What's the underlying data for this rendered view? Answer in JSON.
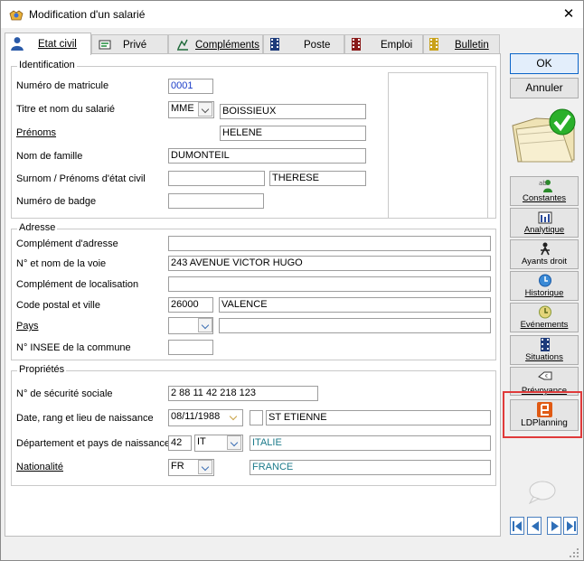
{
  "window": {
    "title": "Modification d'un salarié",
    "close": "✕"
  },
  "tabs": [
    {
      "label": "Etat civil",
      "icon": "person-icon",
      "active": true
    },
    {
      "label": "Privé",
      "icon": "private-icon"
    },
    {
      "label": "Compléments",
      "icon": "complements-icon"
    },
    {
      "label": "Poste",
      "icon": "film-icon"
    },
    {
      "label": "Emploi",
      "icon": "film-red-icon"
    },
    {
      "label": "Bulletin",
      "icon": "film-yellow-icon"
    }
  ],
  "identification": {
    "legend": "Identification",
    "matricule": {
      "label": "Numéro de matricule",
      "value": "0001"
    },
    "titre_nom": {
      "label": "Titre et nom du salarié",
      "civilite": "MME",
      "value": "BOISSIEUX"
    },
    "prenoms": {
      "label": "Prénoms",
      "value": "HELENE"
    },
    "nom_famille": {
      "label": "Nom de famille",
      "value": "DUMONTEIL"
    },
    "surnom": {
      "label": "Surnom / Prénoms d'état civil",
      "value1": "",
      "value2": "THERESE"
    },
    "badge": {
      "label": "Numéro de badge",
      "value": ""
    }
  },
  "adresse": {
    "legend": "Adresse",
    "complement": {
      "label": "Complément d'adresse",
      "value": ""
    },
    "voie": {
      "label": "N° et nom de la voie",
      "value": "243 AVENUE VICTOR HUGO"
    },
    "localisation": {
      "label": "Complément de localisation",
      "value": ""
    },
    "cp_ville": {
      "label": "Code postal et ville",
      "cp": "26000",
      "ville": "VALENCE"
    },
    "pays": {
      "label": "Pays",
      "code": "",
      "name": ""
    },
    "insee": {
      "label": "N° INSEE de la commune",
      "value": ""
    }
  },
  "proprietes": {
    "legend": "Propriétés",
    "secu": {
      "label": "N° de sécurité sociale",
      "value": "2 88 11 42 218 123"
    },
    "naissance": {
      "label": "Date, rang et lieu de naissance",
      "date": "08/11/1988",
      "rang": "",
      "lieu": "ST ETIENNE"
    },
    "dept_pays": {
      "label": "Département et pays de naissance",
      "dept": "42",
      "pays_code": "IT",
      "pays": "ITALIE"
    },
    "nationalite": {
      "label": "Nationalité",
      "code": "FR",
      "value": "FRANCE"
    }
  },
  "buttons": {
    "ok": "OK",
    "annuler": "Annuler"
  },
  "side_buttons": [
    {
      "label": "Constantes",
      "icon": "constantes-icon"
    },
    {
      "label": "Analytique",
      "icon": "analytique-icon"
    },
    {
      "label": "Ayants droit",
      "icon": "ayants-droit-icon"
    },
    {
      "label": "Historique",
      "icon": "clock-icon"
    },
    {
      "label": "Evénements",
      "icon": "events-icon"
    },
    {
      "label": "Situations",
      "icon": "film-icon"
    },
    {
      "label": "Prévoyance",
      "icon": "prevoyance-icon"
    },
    {
      "label": "LDPlanning",
      "icon": "ldplanning-icon"
    }
  ],
  "colors": {
    "highlight": "#e03a3a",
    "accent": "#1a3cc8",
    "teal": "#1b7a8a",
    "nav": "#2f6fb8"
  }
}
